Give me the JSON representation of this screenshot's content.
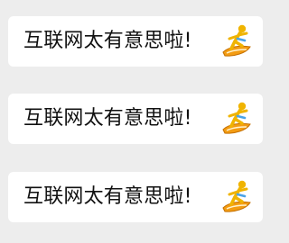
{
  "messages": [
    {
      "text": "互联网太有意思啦!",
      "emoji": "person-surfing-icon"
    },
    {
      "text": "互联网太有意思啦!",
      "emoji": "person-surfing-icon"
    },
    {
      "text": "互联网太有意思啦!",
      "emoji": "person-surfing-icon"
    }
  ],
  "colors": {
    "background": "#ededed",
    "bubble": "#ffffff",
    "text": "#111111",
    "surfboard": "#f39c12",
    "surfer": "#f0b400",
    "wave": "#4aa3e8"
  }
}
